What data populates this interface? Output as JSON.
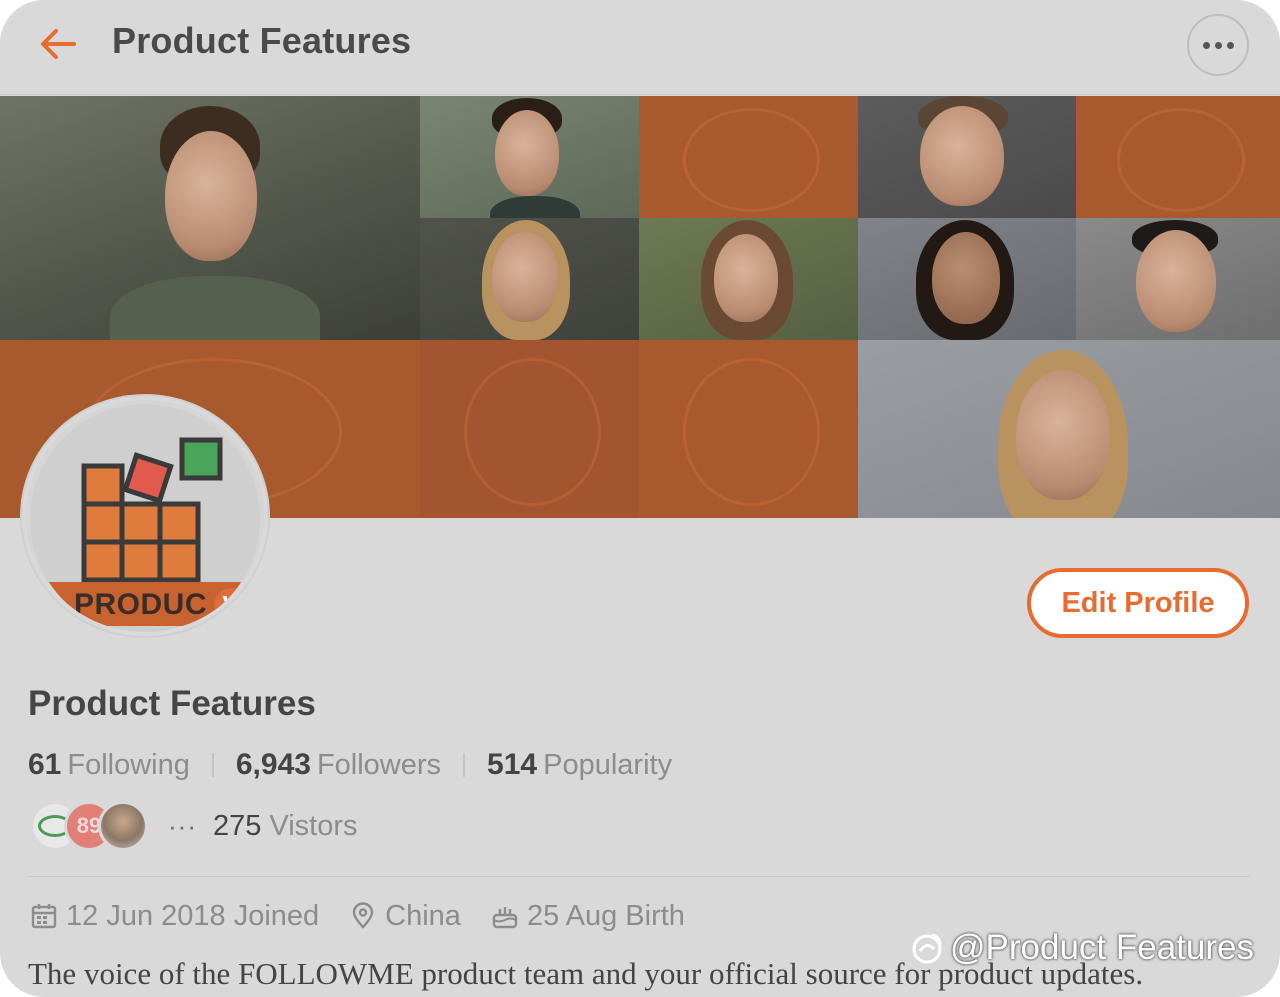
{
  "header": {
    "title": "Product Features",
    "back_icon": "back-arrow-icon",
    "more_icon": "more-horizontal-icon",
    "accent_color": "#e86b30"
  },
  "avatar": {
    "logo_text": "PRODUC",
    "badge": "V"
  },
  "actions": {
    "edit_profile": "Edit Profile"
  },
  "profile": {
    "name": "Product Features",
    "stats": [
      {
        "value": "61",
        "label": "Following"
      },
      {
        "value": "6,943",
        "label": "Followers"
      },
      {
        "value": "514",
        "label": "Popularity"
      }
    ],
    "visitors": {
      "badge_number": "89",
      "dots": "···",
      "count": "275",
      "label": "Vistors"
    },
    "joined": "12 Jun 2018 Joined",
    "location": "China",
    "birthday": "25 Aug Birth",
    "bio": "The voice of the FOLLOWME product team and your official source for product updates."
  },
  "watermark": {
    "text": "@Product Features"
  }
}
